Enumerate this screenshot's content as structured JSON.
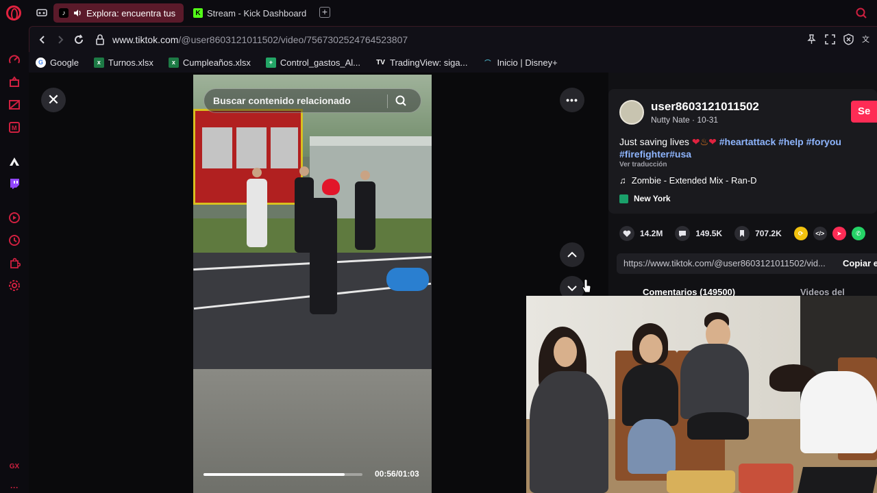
{
  "tabs": [
    {
      "label": "Explora: encuentra tus",
      "active": true
    },
    {
      "label": "Stream - Kick Dashboard",
      "active": false
    }
  ],
  "address": {
    "host": "www.tiktok.com",
    "path": "/@user8603121011502/video/7567302524764523807"
  },
  "bookmarks": [
    {
      "label": "Google",
      "icon": "google-icon"
    },
    {
      "label": "Turnos.xlsx",
      "icon": "excel-icon"
    },
    {
      "label": "Cumpleaños.xlsx",
      "icon": "excel-icon"
    },
    {
      "label": "Control_gastos_Al...",
      "icon": "sheets-icon"
    },
    {
      "label": "TradingView: siga...",
      "icon": "tradingview-icon"
    },
    {
      "label": "Inicio | Disney+",
      "icon": "disney-icon"
    }
  ],
  "video": {
    "search_placeholder": "Buscar contenido relacionado",
    "time": "00:56/01:03",
    "progress": 0.889
  },
  "post": {
    "username": "user8603121011502",
    "subtitle": "Nutty Nate · 10-31",
    "follow_label": "Se",
    "desc_text": "Just saving lives",
    "tags_line1": "#heartattack #help #foryou",
    "tags_line2": "#firefighter#usa",
    "translate": "Ver traducción",
    "music": "Zombie - Extended Mix - Ran-D",
    "location": "New York"
  },
  "stats": {
    "likes": "14.2M",
    "comments": "149.5K",
    "saves": "707.2K"
  },
  "link": {
    "url": "https://www.tiktok.com/@user8603121011502/vid...",
    "copy_label": "Copiar e"
  },
  "section_tabs": {
    "comments": "Comentarios (149500)",
    "creator_videos": "Videos del creador"
  },
  "colors": {
    "accent": "#fe2c55",
    "opera_red": "#e0223f",
    "hashtag": "#8fb6ff"
  }
}
